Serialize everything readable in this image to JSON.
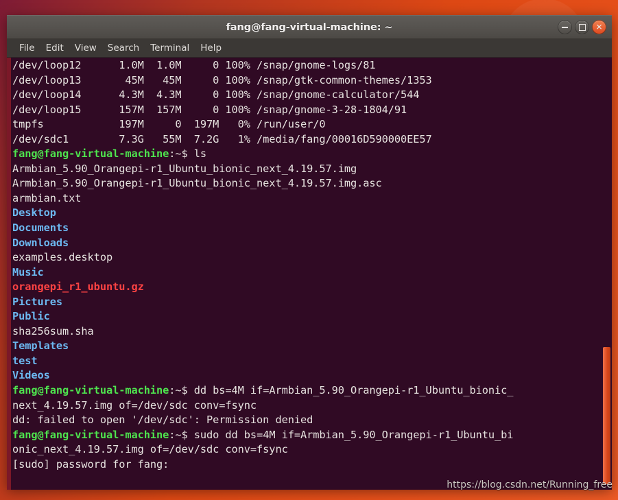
{
  "desktop": {
    "wallpaper_color": "#dd4814"
  },
  "window": {
    "title": "fang@fang-virtual-machine: ~",
    "controls": {
      "minimize_label": "−",
      "maximize_label": "□",
      "close_label": "✕"
    },
    "border_color": "#7b1828",
    "background_color": "#300a24"
  },
  "menubar": {
    "items": [
      {
        "label": "File"
      },
      {
        "label": "Edit"
      },
      {
        "label": "View"
      },
      {
        "label": "Search"
      },
      {
        "label": "Terminal"
      },
      {
        "label": "Help"
      }
    ]
  },
  "terminal": {
    "colors": {
      "background": "#300a24",
      "foreground": "#e6e2df",
      "prompt_green": "#4ee44e",
      "directory_blue": "#6cb8f0",
      "archive_red": "#ff4343"
    },
    "lines": [
      {
        "id": "l01",
        "segments": [
          {
            "text": "/dev/loop12      1.0M  1.0M     0 100% /snap/gnome-logs/81",
            "style": "plain"
          }
        ]
      },
      {
        "id": "l02",
        "segments": [
          {
            "text": "/dev/loop13       45M   45M     0 100% /snap/gtk-common-themes/1353",
            "style": "plain"
          }
        ]
      },
      {
        "id": "l03",
        "segments": [
          {
            "text": "/dev/loop14      4.3M  4.3M     0 100% /snap/gnome-calculator/544",
            "style": "plain"
          }
        ]
      },
      {
        "id": "l04",
        "segments": [
          {
            "text": "/dev/loop15      157M  157M     0 100% /snap/gnome-3-28-1804/91",
            "style": "plain"
          }
        ]
      },
      {
        "id": "l05",
        "segments": [
          {
            "text": "tmpfs            197M     0  197M   0% /run/user/0",
            "style": "plain"
          }
        ]
      },
      {
        "id": "l06",
        "segments": [
          {
            "text": "/dev/sdc1        7.3G   55M  7.2G   1% /media/fang/00016D590000EE57",
            "style": "plain"
          }
        ]
      },
      {
        "id": "l07",
        "segments": [
          {
            "text": "fang@fang-virtual-machine",
            "style": "b-green"
          },
          {
            "text": ":~$ ls",
            "style": "plain"
          }
        ]
      },
      {
        "id": "l08",
        "segments": [
          {
            "text": "Armbian_5.90_Orangepi-r1_Ubuntu_bionic_next_4.19.57.img",
            "style": "plain"
          }
        ]
      },
      {
        "id": "l09",
        "segments": [
          {
            "text": "Armbian_5.90_Orangepi-r1_Ubuntu_bionic_next_4.19.57.img.asc",
            "style": "plain"
          }
        ]
      },
      {
        "id": "l10",
        "segments": [
          {
            "text": "armbian.txt",
            "style": "plain"
          }
        ]
      },
      {
        "id": "l11",
        "segments": [
          {
            "text": "Desktop",
            "style": "b-blue"
          }
        ]
      },
      {
        "id": "l12",
        "segments": [
          {
            "text": "Documents",
            "style": "b-blue"
          }
        ]
      },
      {
        "id": "l13",
        "segments": [
          {
            "text": "Downloads",
            "style": "b-blue"
          }
        ]
      },
      {
        "id": "l14",
        "segments": [
          {
            "text": "examples.desktop",
            "style": "plain"
          }
        ]
      },
      {
        "id": "l15",
        "segments": [
          {
            "text": "Music",
            "style": "b-blue"
          }
        ]
      },
      {
        "id": "l16",
        "segments": [
          {
            "text": "orangepi_r1_ubuntu.gz",
            "style": "b-red"
          }
        ]
      },
      {
        "id": "l17",
        "segments": [
          {
            "text": "Pictures",
            "style": "b-blue"
          }
        ]
      },
      {
        "id": "l18",
        "segments": [
          {
            "text": "Public",
            "style": "b-blue"
          }
        ]
      },
      {
        "id": "l19",
        "segments": [
          {
            "text": "sha256sum.sha",
            "style": "plain"
          }
        ]
      },
      {
        "id": "l20",
        "segments": [
          {
            "text": "Templates",
            "style": "b-blue"
          }
        ]
      },
      {
        "id": "l21",
        "segments": [
          {
            "text": "test",
            "style": "b-blue"
          }
        ]
      },
      {
        "id": "l22",
        "segments": [
          {
            "text": "Videos",
            "style": "b-blue"
          }
        ]
      },
      {
        "id": "l23",
        "segments": [
          {
            "text": "fang@fang-virtual-machine",
            "style": "b-green"
          },
          {
            "text": ":~$ dd bs=4M if=Armbian_5.90_Orangepi-r1_Ubuntu_bionic_",
            "style": "plain"
          }
        ]
      },
      {
        "id": "l24",
        "segments": [
          {
            "text": "next_4.19.57.img of=/dev/sdc conv=fsync",
            "style": "plain"
          }
        ]
      },
      {
        "id": "l25",
        "segments": [
          {
            "text": "dd: failed to open '/dev/sdc': Permission denied",
            "style": "plain"
          }
        ]
      },
      {
        "id": "l26",
        "segments": [
          {
            "text": "fang@fang-virtual-machine",
            "style": "b-green"
          },
          {
            "text": ":~$ sudo dd bs=4M if=Armbian_5.90_Orangepi-r1_Ubuntu_bi",
            "style": "plain"
          }
        ]
      },
      {
        "id": "l27",
        "segments": [
          {
            "text": "onic_next_4.19.57.img of=/dev/sdc conv=fsync",
            "style": "plain"
          }
        ]
      },
      {
        "id": "l28",
        "segments": [
          {
            "text": "[sudo] password for fang:",
            "style": "plain"
          }
        ]
      }
    ]
  },
  "scrollbar": {
    "thumb_color": "#d8451a"
  },
  "watermark": {
    "text": "https://blog.csdn.net/Running_free"
  }
}
